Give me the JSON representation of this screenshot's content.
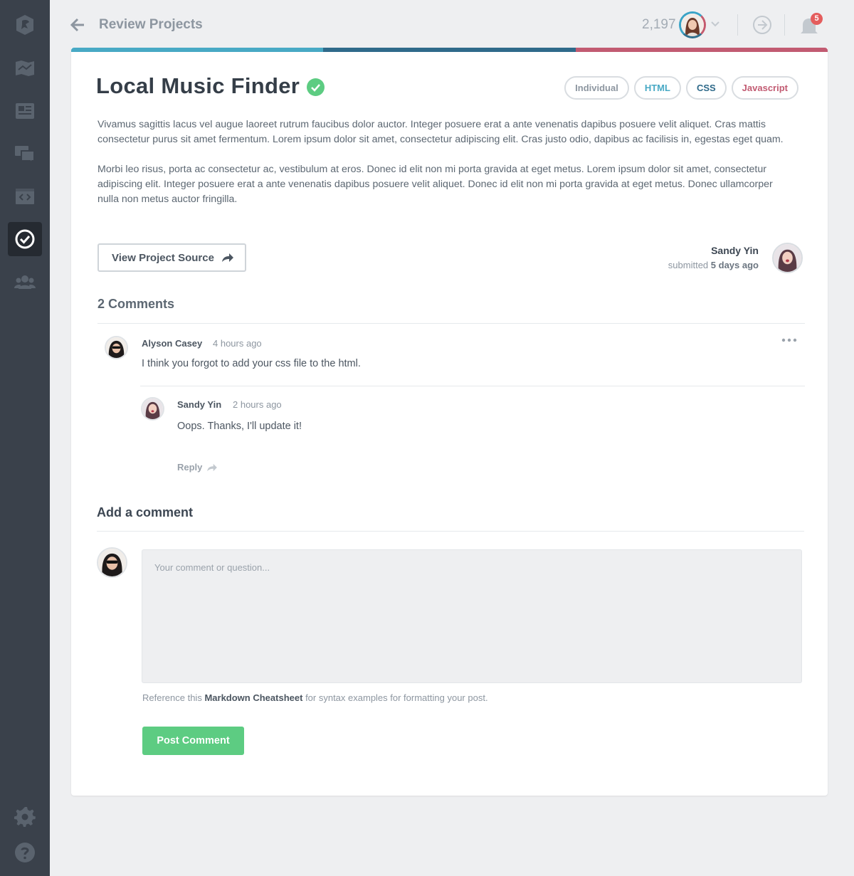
{
  "header": {
    "title": "Review Projects",
    "points": "2,197",
    "notification_count": "5"
  },
  "colors": {
    "accent_teal": "#48a9c5",
    "accent_navy": "#2f6a8a",
    "accent_rose": "#c25b72",
    "success_green": "#5dcc82",
    "sidebar_bg": "#3a414b"
  },
  "sidebar": {
    "items": [
      {
        "icon": "treehouse-logo-icon"
      },
      {
        "icon": "map-icon"
      },
      {
        "icon": "news-icon"
      },
      {
        "icon": "chat-icon"
      },
      {
        "icon": "code-window-icon"
      },
      {
        "icon": "check-circle-icon",
        "active": true
      },
      {
        "icon": "people-icon"
      }
    ],
    "bottom_items": [
      {
        "icon": "gear-icon"
      },
      {
        "icon": "help-icon"
      }
    ]
  },
  "project": {
    "title": "Local Music Finder",
    "tags": [
      {
        "label": "Individual",
        "color": "#8d96a0"
      },
      {
        "label": "HTML",
        "color": "#48a9c5"
      },
      {
        "label": "CSS",
        "color": "#2f6a8a"
      },
      {
        "label": "Javascript",
        "color": "#c25b72"
      }
    ],
    "paragraphs": [
      "Vivamus sagittis lacus vel augue laoreet rutrum faucibus dolor auctor. Integer posuere erat a ante venenatis dapibus posuere velit aliquet. Cras mattis consectetur purus sit amet fermentum. Lorem ipsum dolor sit amet, consectetur adipiscing elit. Cras justo odio, dapibus ac facilisis in, egestas eget quam.",
      "Morbi leo risus, porta ac consectetur ac, vestibulum at eros. Donec id elit non mi porta gravida at eget metus. Lorem ipsum dolor sit amet, consectetur adipiscing elit. Integer posuere erat a ante venenatis dapibus posuere velit aliquet. Donec id elit non mi porta gravida at eget metus. Donec ullamcorper nulla non metus auctor fringilla."
    ],
    "source_button": "View Project Source",
    "submitter": {
      "name": "Sandy Yin",
      "submitted_prefix": "submitted",
      "submitted_when": "5 days ago"
    }
  },
  "comments": {
    "title": "2 Comments",
    "items": [
      {
        "author": "Alyson Casey",
        "time": "4 hours ago",
        "text": "I think you forgot to add your css file to the html."
      },
      {
        "author": "Sandy Yin",
        "time": "2 hours ago",
        "text": "Oops. Thanks, I'll update it!"
      }
    ],
    "reply_label": "Reply"
  },
  "add_comment": {
    "title": "Add a comment",
    "placeholder": "Your comment or question...",
    "hint_prefix": "Reference this",
    "hint_link": "Markdown Cheatsheet",
    "hint_suffix": "for syntax examples for formatting your post.",
    "submit_label": "Post Comment"
  }
}
